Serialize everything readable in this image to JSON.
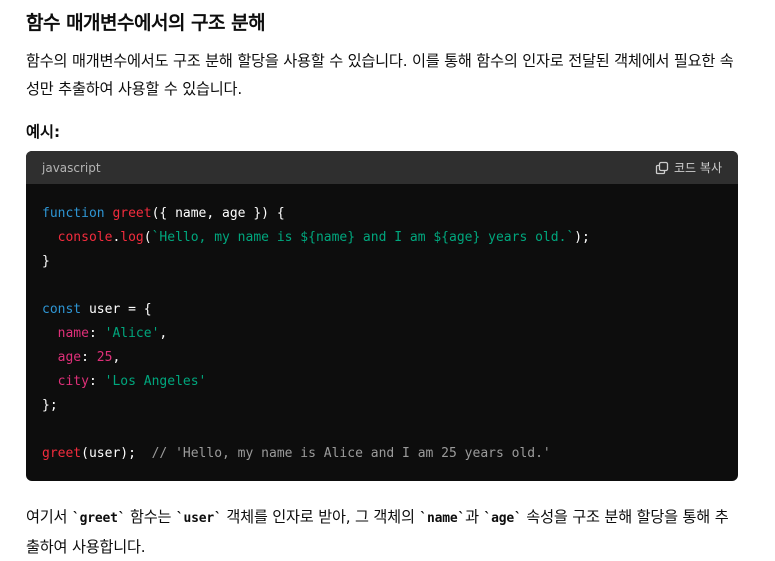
{
  "heading": "함수 매개변수에서의 구조 분해",
  "intro": "함수의 매개변수에서도 구조 분해 할당을 사용할 수 있습니다. 이를 통해 함수의 인자로 전달된 객체에서 필요한 속성만 추출하여 사용할 수 있습니다.",
  "example_label": "예시:",
  "code_block": {
    "language": "javascript",
    "copy_label": "코드 복사",
    "copy_icon": "copy-icon",
    "colors": {
      "background": "#0d0d0d",
      "header": "#2f2f2f",
      "keyword": "#2e95d3",
      "function": "#f22c3d",
      "string": "#00a67d",
      "number": "#df3079",
      "comment": "#9b9b9b"
    },
    "lines": [
      [
        {
          "t": "kw",
          "v": "function"
        },
        {
          "t": "",
          "v": " "
        },
        {
          "t": "fn",
          "v": "greet"
        },
        {
          "t": "",
          "v": "({ name, age }) {"
        }
      ],
      [
        {
          "t": "",
          "v": "  "
        },
        {
          "t": "fn",
          "v": "console"
        },
        {
          "t": "",
          "v": "."
        },
        {
          "t": "fn",
          "v": "log"
        },
        {
          "t": "",
          "v": "("
        },
        {
          "t": "str",
          "v": "`Hello, my name is ${name} and I am ${age} years old.`"
        },
        {
          "t": "",
          "v": ");"
        }
      ],
      [
        {
          "t": "",
          "v": "}"
        }
      ],
      [
        {
          "t": "",
          "v": ""
        }
      ],
      [
        {
          "t": "kw",
          "v": "const"
        },
        {
          "t": "",
          "v": " user = {"
        }
      ],
      [
        {
          "t": "",
          "v": "  "
        },
        {
          "t": "prop",
          "v": "name"
        },
        {
          "t": "",
          "v": ": "
        },
        {
          "t": "str",
          "v": "'Alice'"
        },
        {
          "t": "",
          "v": ","
        }
      ],
      [
        {
          "t": "",
          "v": "  "
        },
        {
          "t": "prop",
          "v": "age"
        },
        {
          "t": "",
          "v": ": "
        },
        {
          "t": "num",
          "v": "25"
        },
        {
          "t": "",
          "v": ","
        }
      ],
      [
        {
          "t": "",
          "v": "  "
        },
        {
          "t": "prop",
          "v": "city"
        },
        {
          "t": "",
          "v": ": "
        },
        {
          "t": "str",
          "v": "'Los Angeles'"
        }
      ],
      [
        {
          "t": "",
          "v": "};"
        }
      ],
      [
        {
          "t": "",
          "v": ""
        }
      ],
      [
        {
          "t": "fn",
          "v": "greet"
        },
        {
          "t": "",
          "v": "(user);  "
        },
        {
          "t": "cm",
          "v": "// 'Hello, my name is Alice and I am 25 years old.'"
        }
      ]
    ]
  },
  "explanation": {
    "t1": "여기서 ",
    "c1": "`greet`",
    "t2": " 함수는 ",
    "c2": "`user`",
    "t3": " 객체를 인자로 받아, 그 객체의 ",
    "c3": "`name`",
    "t4": "과 ",
    "c4": "`age`",
    "t5": " 속성을 구조 분해 할당을 통해 추출하여 사용합니다."
  }
}
